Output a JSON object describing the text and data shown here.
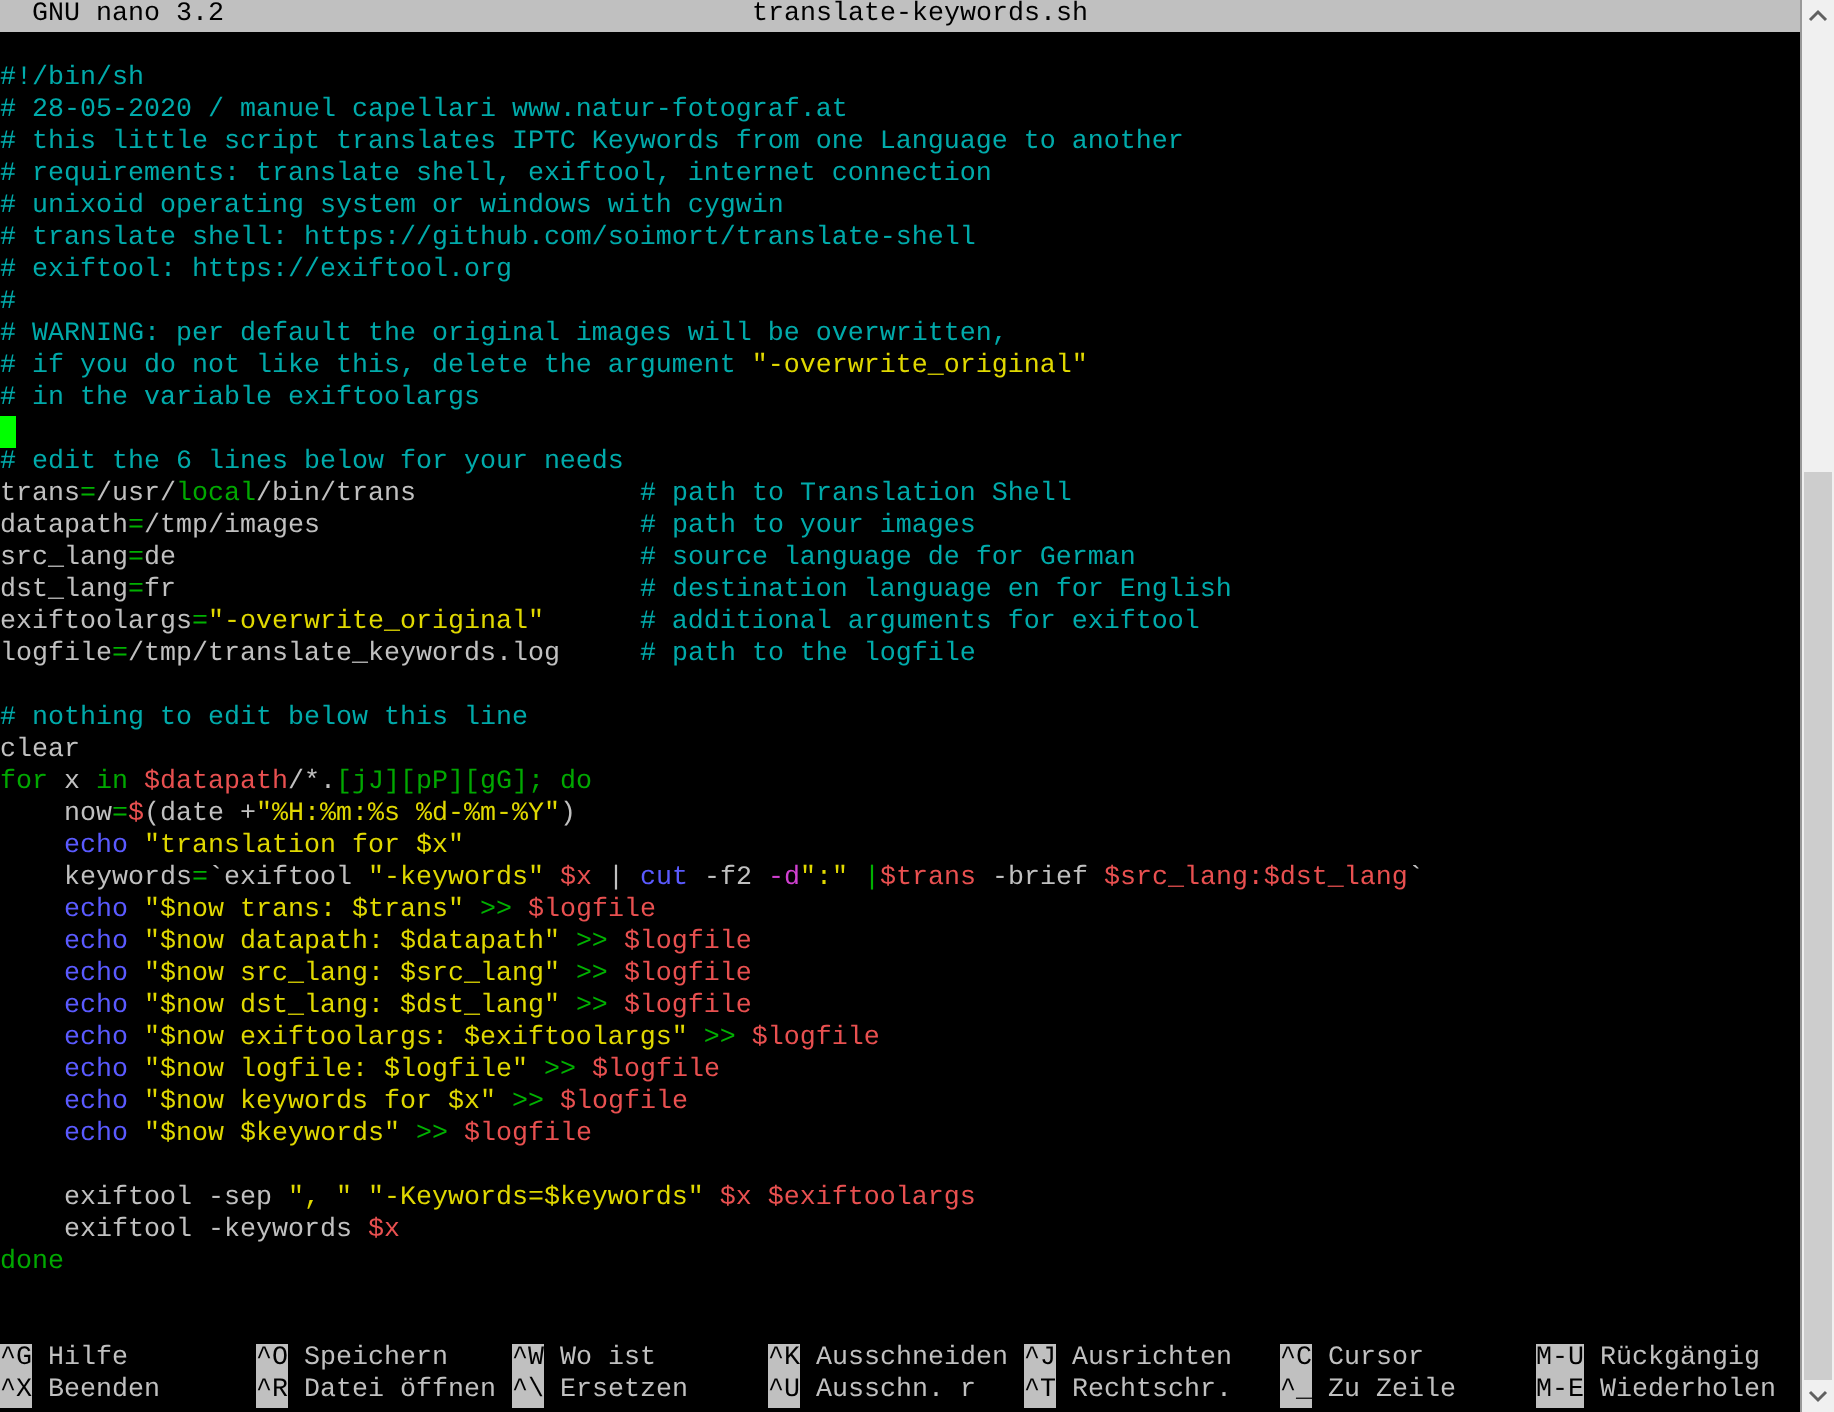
{
  "title_bar": {
    "app": "GNU nano 3.2",
    "file": "translate-keywords.sh"
  },
  "lines": [
    {
      "cursor": false,
      "tokens": [
        {
          "text": "#!/bin/sh",
          "kind": "comment"
        }
      ]
    },
    {
      "cursor": false,
      "tokens": [
        {
          "text": "# 28-05-2020 / manuel capellari www.natur-fotograf.at",
          "kind": "comment"
        }
      ]
    },
    {
      "cursor": false,
      "tokens": [
        {
          "text": "# this little script translates IPTC Keywords from one Language to another",
          "kind": "comment"
        }
      ]
    },
    {
      "cursor": false,
      "tokens": [
        {
          "text": "# requirements: translate shell, exiftool, internet connection",
          "kind": "comment"
        }
      ]
    },
    {
      "cursor": false,
      "tokens": [
        {
          "text": "# unixoid operating system or windows with cygwin",
          "kind": "comment"
        }
      ]
    },
    {
      "cursor": false,
      "tokens": [
        {
          "text": "# translate shell: https://github.com/soimort/translate-shell",
          "kind": "comment"
        }
      ]
    },
    {
      "cursor": false,
      "tokens": [
        {
          "text": "# exiftool: https://exiftool.org",
          "kind": "comment"
        }
      ]
    },
    {
      "cursor": false,
      "tokens": [
        {
          "text": "#",
          "kind": "comment"
        }
      ]
    },
    {
      "cursor": false,
      "tokens": [
        {
          "text": "# WARNING: per default the original images will be overwritten,",
          "kind": "comment"
        }
      ]
    },
    {
      "cursor": false,
      "tokens": [
        {
          "text": "# if you do not like this, delete the argument ",
          "kind": "comment"
        },
        {
          "text": "\"-overwrite_original\"",
          "kind": "string"
        }
      ]
    },
    {
      "cursor": false,
      "tokens": [
        {
          "text": "# in the variable exiftoolargs",
          "kind": "comment"
        }
      ]
    },
    {
      "cursor": true
    },
    {
      "cursor": false,
      "tokens": [
        {
          "text": "# edit the 6 lines below for your needs",
          "kind": "comment"
        }
      ]
    },
    {
      "cursor": false,
      "tokens": [
        {
          "text": "trans",
          "kind": "plain"
        },
        {
          "text": "=",
          "kind": "operator"
        },
        {
          "text": "/usr/",
          "kind": "plain"
        },
        {
          "text": "local",
          "kind": "keyword"
        },
        {
          "text": "/bin/trans              ",
          "kind": "plain"
        },
        {
          "text": "# path to Translation Shell",
          "kind": "comment"
        }
      ]
    },
    {
      "cursor": false,
      "tokens": [
        {
          "text": "datapath",
          "kind": "plain"
        },
        {
          "text": "=",
          "kind": "operator"
        },
        {
          "text": "/tmp/images                    ",
          "kind": "plain"
        },
        {
          "text": "# path to your images",
          "kind": "comment"
        }
      ]
    },
    {
      "cursor": false,
      "tokens": [
        {
          "text": "src_lang",
          "kind": "plain"
        },
        {
          "text": "=",
          "kind": "operator"
        },
        {
          "text": "de                             ",
          "kind": "plain"
        },
        {
          "text": "# source language de for German",
          "kind": "comment"
        }
      ]
    },
    {
      "cursor": false,
      "tokens": [
        {
          "text": "dst_lang",
          "kind": "plain"
        },
        {
          "text": "=",
          "kind": "operator"
        },
        {
          "text": "fr                             ",
          "kind": "plain"
        },
        {
          "text": "# destination language en for English",
          "kind": "comment"
        }
      ]
    },
    {
      "cursor": false,
      "tokens": [
        {
          "text": "exiftoolargs",
          "kind": "plain"
        },
        {
          "text": "=",
          "kind": "operator"
        },
        {
          "text": "\"-overwrite_original\"      ",
          "kind": "string"
        },
        {
          "text": "# additional arguments for exiftool",
          "kind": "comment"
        }
      ]
    },
    {
      "cursor": false,
      "tokens": [
        {
          "text": "logfile",
          "kind": "plain"
        },
        {
          "text": "=",
          "kind": "operator"
        },
        {
          "text": "/tmp/translate_keywords.log     ",
          "kind": "plain"
        },
        {
          "text": "# path to the logfile",
          "kind": "comment"
        }
      ]
    },
    {
      "cursor": false
    },
    {
      "cursor": false,
      "tokens": [
        {
          "text": "# nothing to edit below this line",
          "kind": "comment"
        }
      ]
    },
    {
      "cursor": false,
      "tokens": [
        {
          "text": "clear",
          "kind": "plain"
        }
      ]
    },
    {
      "cursor": false,
      "tokens": [
        {
          "text": "for",
          "kind": "keyword"
        },
        {
          "text": " x ",
          "kind": "plain"
        },
        {
          "text": "in ",
          "kind": "keyword"
        },
        {
          "text": "$datapath",
          "kind": "variable"
        },
        {
          "text": "/*.",
          "kind": "plain"
        },
        {
          "text": "[jJ][pP][gG]; do",
          "kind": "keyword"
        }
      ]
    },
    {
      "cursor": false,
      "tokens": [
        {
          "text": "    now",
          "kind": "plain"
        },
        {
          "text": "=",
          "kind": "operator"
        },
        {
          "text": "$",
          "kind": "variable"
        },
        {
          "text": "(date +",
          "kind": "plain"
        },
        {
          "text": "\"%H:%m:%s %d-%m-%Y\"",
          "kind": "string"
        },
        {
          "text": ")",
          "kind": "plain"
        }
      ]
    },
    {
      "cursor": false,
      "tokens": [
        {
          "text": "    echo ",
          "kind": "command"
        },
        {
          "text": "\"translation for $x\"",
          "kind": "string"
        }
      ]
    },
    {
      "cursor": false,
      "tokens": [
        {
          "text": "    keywords",
          "kind": "plain"
        },
        {
          "text": "=",
          "kind": "operator"
        },
        {
          "text": "`exiftool ",
          "kind": "plain"
        },
        {
          "text": "\"-keywords\" ",
          "kind": "string"
        },
        {
          "text": "$x",
          "kind": "variable"
        },
        {
          "text": " | ",
          "kind": "plain"
        },
        {
          "text": "cut",
          "kind": "command"
        },
        {
          "text": " -f2 ",
          "kind": "plain"
        },
        {
          "text": "-d",
          "kind": "option"
        },
        {
          "text": "\":\" ",
          "kind": "string"
        },
        {
          "text": "|",
          "kind": "operator"
        },
        {
          "text": "$trans",
          "kind": "variable"
        },
        {
          "text": " -brief ",
          "kind": "plain"
        },
        {
          "text": "$src_lang:$dst_lang",
          "kind": "variable"
        },
        {
          "text": "`",
          "kind": "plain"
        }
      ]
    },
    {
      "cursor": false,
      "tokens": [
        {
          "text": "    echo ",
          "kind": "command"
        },
        {
          "text": "\"$now trans: $trans\" ",
          "kind": "string"
        },
        {
          "text": ">> ",
          "kind": "operator"
        },
        {
          "text": "$logfile",
          "kind": "variable"
        }
      ]
    },
    {
      "cursor": false,
      "tokens": [
        {
          "text": "    echo ",
          "kind": "command"
        },
        {
          "text": "\"$now datapath: $datapath\" ",
          "kind": "string"
        },
        {
          "text": ">> ",
          "kind": "operator"
        },
        {
          "text": "$logfile",
          "kind": "variable"
        }
      ]
    },
    {
      "cursor": false,
      "tokens": [
        {
          "text": "    echo ",
          "kind": "command"
        },
        {
          "text": "\"$now src_lang: $src_lang\" ",
          "kind": "string"
        },
        {
          "text": ">> ",
          "kind": "operator"
        },
        {
          "text": "$logfile",
          "kind": "variable"
        }
      ]
    },
    {
      "cursor": false,
      "tokens": [
        {
          "text": "    echo ",
          "kind": "command"
        },
        {
          "text": "\"$now dst_lang: $dst_lang\" ",
          "kind": "string"
        },
        {
          "text": ">> ",
          "kind": "operator"
        },
        {
          "text": "$logfile",
          "kind": "variable"
        }
      ]
    },
    {
      "cursor": false,
      "tokens": [
        {
          "text": "    echo ",
          "kind": "command"
        },
        {
          "text": "\"$now exiftoolargs: $exiftoolargs\" ",
          "kind": "string"
        },
        {
          "text": ">> ",
          "kind": "operator"
        },
        {
          "text": "$logfile",
          "kind": "variable"
        }
      ]
    },
    {
      "cursor": false,
      "tokens": [
        {
          "text": "    echo ",
          "kind": "command"
        },
        {
          "text": "\"$now logfile: $logfile\" ",
          "kind": "string"
        },
        {
          "text": ">> ",
          "kind": "operator"
        },
        {
          "text": "$logfile",
          "kind": "variable"
        }
      ]
    },
    {
      "cursor": false,
      "tokens": [
        {
          "text": "    echo ",
          "kind": "command"
        },
        {
          "text": "\"$now keywords for $x\" ",
          "kind": "string"
        },
        {
          "text": ">> ",
          "kind": "operator"
        },
        {
          "text": "$logfile",
          "kind": "variable"
        }
      ]
    },
    {
      "cursor": false,
      "tokens": [
        {
          "text": "    echo ",
          "kind": "command"
        },
        {
          "text": "\"$now $keywords\" ",
          "kind": "string"
        },
        {
          "text": ">> ",
          "kind": "operator"
        },
        {
          "text": "$logfile",
          "kind": "variable"
        }
      ]
    },
    {
      "cursor": false
    },
    {
      "cursor": false,
      "tokens": [
        {
          "text": "    exiftool -sep ",
          "kind": "plain"
        },
        {
          "text": "\", \" \"-Keywords=$keywords\" ",
          "kind": "string"
        },
        {
          "text": "$x $exiftoolargs",
          "kind": "variable"
        }
      ]
    },
    {
      "cursor": false,
      "tokens": [
        {
          "text": "    exiftool -keywords ",
          "kind": "plain"
        },
        {
          "text": "$x",
          "kind": "variable"
        }
      ]
    },
    {
      "cursor": false,
      "tokens": [
        {
          "text": "done",
          "kind": "keyword"
        }
      ]
    }
  ],
  "shortcut_rows": [
    [
      {
        "key": "^G",
        "label": "Hilfe"
      },
      {
        "key": "^O",
        "label": "Speichern"
      },
      {
        "key": "^W",
        "label": "Wo ist"
      },
      {
        "key": "^K",
        "label": "Ausschneiden"
      },
      {
        "key": "^J",
        "label": "Ausrichten"
      },
      {
        "key": "^C",
        "label": "Cursor"
      },
      {
        "key": "M-U",
        "label": "Rückgängig"
      }
    ],
    [
      {
        "key": "^X",
        "label": "Beenden"
      },
      {
        "key": "^R",
        "label": "Datei öffnen"
      },
      {
        "key": "^\\",
        "label": "Ersetzen"
      },
      {
        "key": "^U",
        "label": "Ausschn. r"
      },
      {
        "key": "^T",
        "label": "Rechtschr."
      },
      {
        "key": "^_",
        "label": "Zu Zeile"
      },
      {
        "key": "M-E",
        "label": "Wiederholen"
      }
    ]
  ]
}
